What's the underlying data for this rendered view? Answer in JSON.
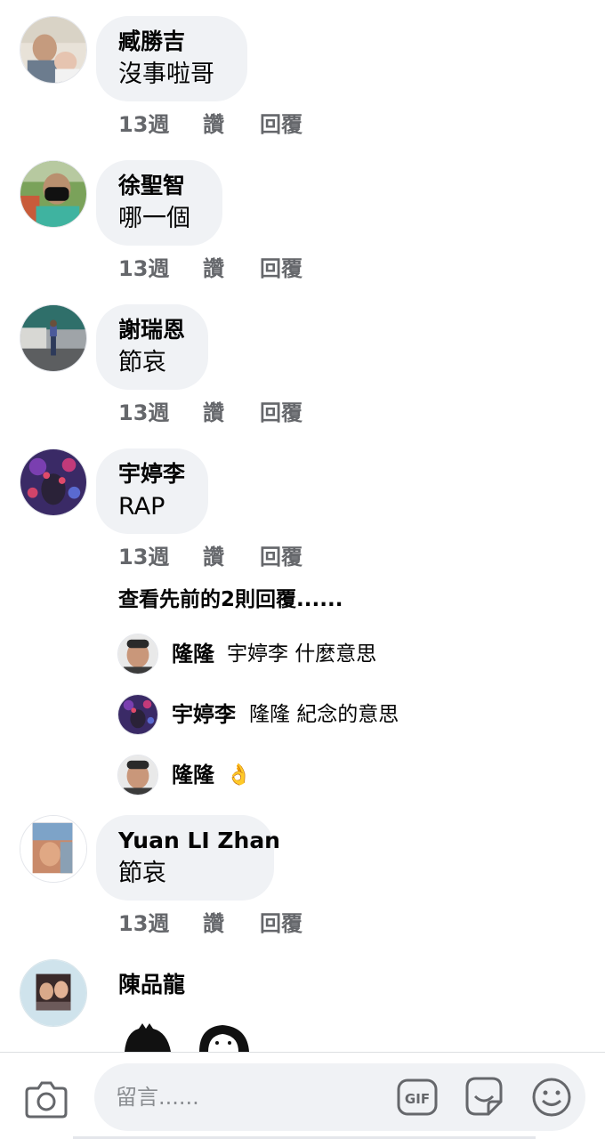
{
  "comments": [
    {
      "author": "臧勝吉",
      "text": "沒事啦哥",
      "time": "13週",
      "like": "讚",
      "reply": "回覆",
      "avatar_icon": "profile-photo-icon"
    },
    {
      "author": "徐聖智",
      "text": "哪一個",
      "time": "13週",
      "like": "讚",
      "reply": "回覆",
      "avatar_icon": "profile-photo-icon"
    },
    {
      "author": "謝瑞恩",
      "text": "節哀",
      "time": "13週",
      "like": "讚",
      "reply": "回覆",
      "avatar_icon": "profile-photo-icon"
    },
    {
      "author": "宇婷李",
      "text": "RAP",
      "time": "13週",
      "like": "讚",
      "reply": "回覆",
      "avatar_icon": "profile-photo-icon"
    },
    {
      "author": "Yuan LI Zhan",
      "text": "節哀",
      "time": "13週",
      "like": "讚",
      "reply": "回覆",
      "avatar_icon": "profile-photo-icon"
    },
    {
      "author": "陳品龍",
      "avatar_icon": "profile-photo-icon"
    }
  ],
  "view_previous_replies": "查看先前的2則回覆......",
  "replies": [
    {
      "author": "隆隆",
      "text": "宇婷李 什麼意思"
    },
    {
      "author": "宇婷李",
      "text": "隆隆 紀念的意思"
    },
    {
      "author": "隆隆",
      "text": "👌"
    }
  ],
  "composer": {
    "placeholder": "留言......",
    "camera_icon": "camera-icon",
    "gif_icon": "gif-icon",
    "sticker_icon": "sticker-icon",
    "emoji_icon": "emoji-icon",
    "gif_label": "GIF"
  },
  "colors": {
    "bubble": "#f0f2f5",
    "meta_text": "#65676b",
    "placeholder": "#8a8d91"
  }
}
